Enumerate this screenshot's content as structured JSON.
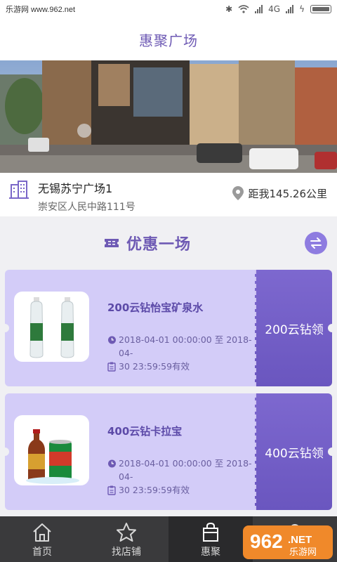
{
  "status_bar": {
    "left_text": "乐游网 www.962.net",
    "network": "4G"
  },
  "header": {
    "title": "惠聚广场"
  },
  "mall": {
    "name": "无锡苏宁广场1",
    "address": "崇安区人民中路111号",
    "distance": "距我145.26公里"
  },
  "section": {
    "title": "优惠一场"
  },
  "coupons": [
    {
      "title": "200云钻怡宝矿泉水",
      "time_line1": "2018-04-01 00:00:00 至 2018-04-",
      "time_line2": "30 23:59:59有效",
      "action": "200云钻领",
      "image": "water-bottles"
    },
    {
      "title": "400云钻卡拉宝",
      "time_line1": "2018-04-01 00:00:00 至 2018-04-",
      "time_line2": "30 23:59:59有效",
      "action": "400云钻领",
      "image": "energy-drink"
    }
  ],
  "tabs": [
    {
      "label": "首页",
      "icon": "home-icon"
    },
    {
      "label": "找店铺",
      "icon": "star-icon"
    },
    {
      "label": "惠聚",
      "icon": "bag-icon",
      "active": true
    },
    {
      "label": "",
      "icon": ""
    }
  ],
  "watermark": {
    "brand": "962",
    "suffix": ".NET",
    "sub": "乐游网"
  },
  "colors": {
    "accent": "#6e5ab4",
    "coupon_body": "#d3ccf8",
    "coupon_stub": "#7d68cf",
    "tabbar": "#3a3a3c"
  }
}
